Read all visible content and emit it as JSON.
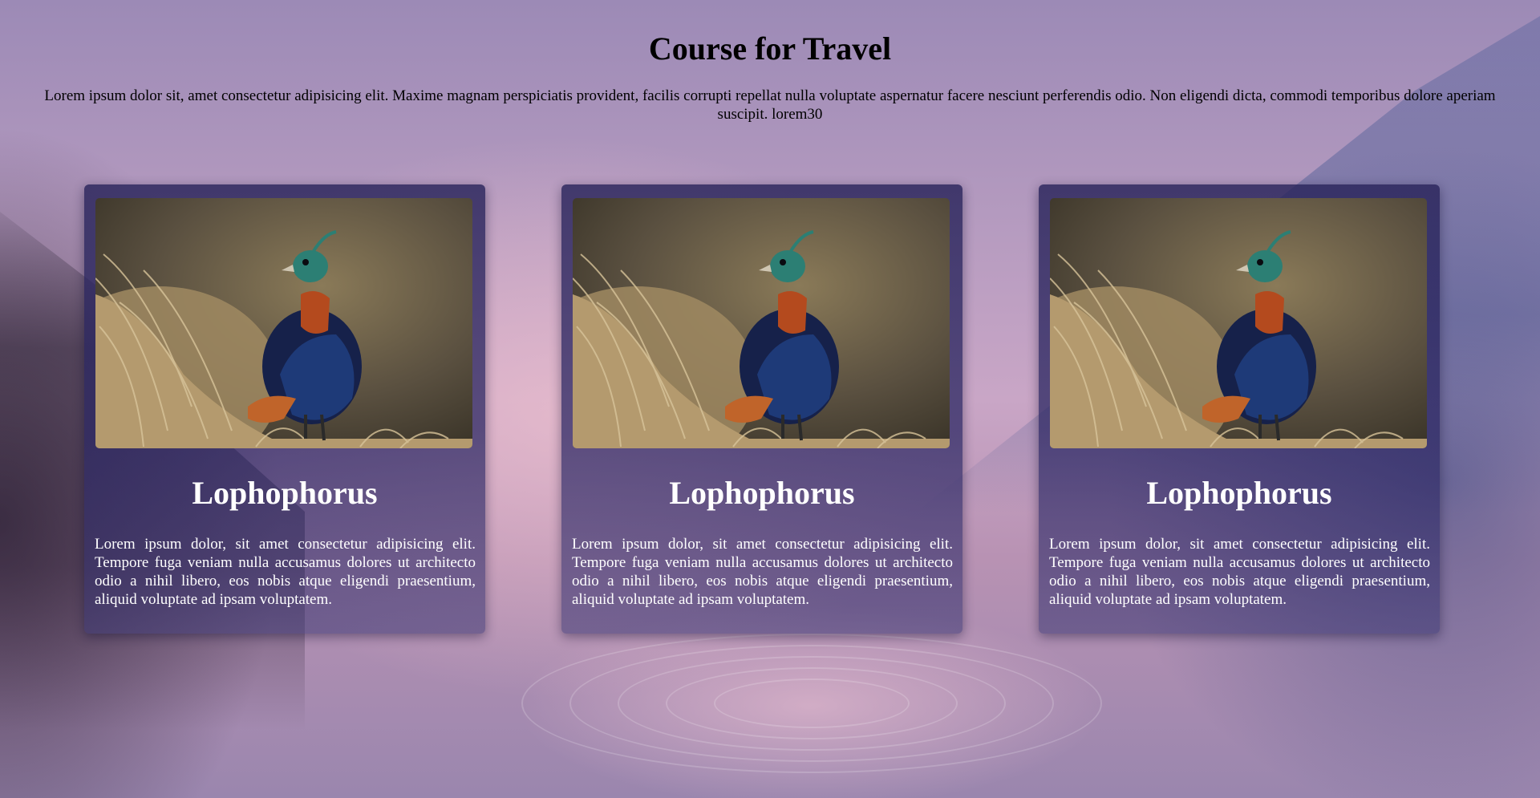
{
  "header": {
    "title": "Course for Travel",
    "intro": "Lorem ipsum dolor sit, amet consectetur adipisicing elit. Maxime magnam perspiciatis provident, facilis corrupti repellat nulla voluptate aspernatur facere nesciunt perferendis odio. Non eligendi dicta, commodi temporibus dolore aperiam suscipit. lorem30"
  },
  "cards": [
    {
      "title": "Lophophorus",
      "text": "Lorem ipsum dolor, sit amet consectetur adipisicing elit. Tempore fuga veniam nulla accusamus dolores ut architecto odio a nihil libero, eos nobis atque eligendi praesentium, aliquid voluptate ad ipsam voluptatem.",
      "image": "bird-photo"
    },
    {
      "title": "Lophophorus",
      "text": "Lorem ipsum dolor, sit amet consectetur adipisicing elit. Tempore fuga veniam nulla accusamus dolores ut architecto odio a nihil libero, eos nobis atque eligendi praesentium, aliquid voluptate ad ipsam voluptatem.",
      "image": "bird-photo"
    },
    {
      "title": "Lophophorus",
      "text": "Lorem ipsum dolor, sit amet consectetur adipisicing elit. Tempore fuga veniam nulla accusamus dolores ut architecto odio a nihil libero, eos nobis atque eligendi praesentium, aliquid voluptate ad ipsam voluptatem.",
      "image": "bird-photo"
    }
  ],
  "colors": {
    "card_background": "#2a2660",
    "text_light": "#ffffff",
    "text_dark": "#000000"
  }
}
